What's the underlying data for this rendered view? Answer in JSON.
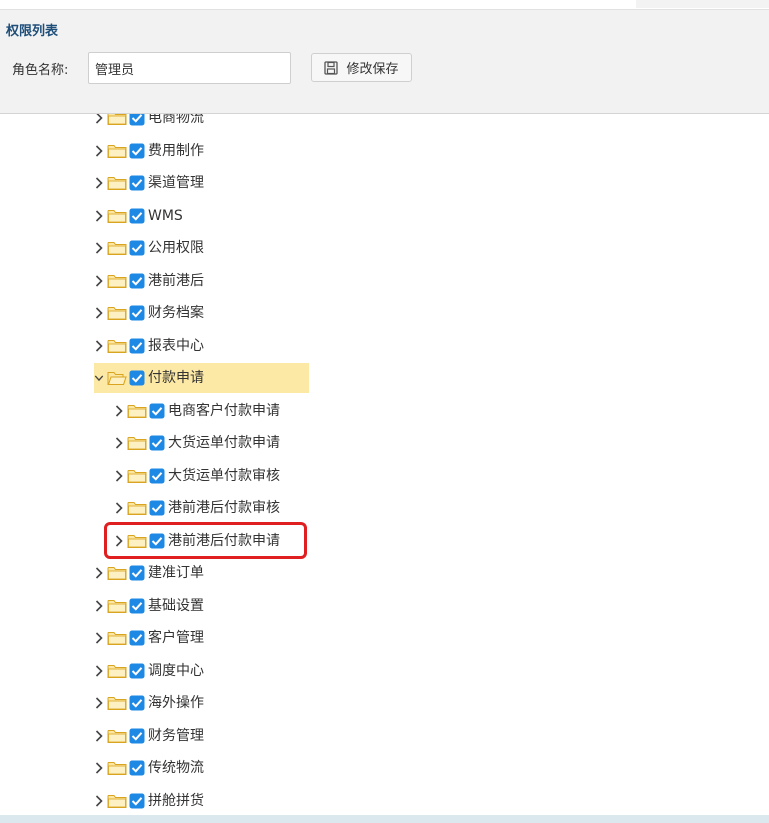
{
  "panel": {
    "title": "权限列表",
    "role_label": "角色名称:",
    "role_value": "管理员",
    "save_label": "修改保存"
  },
  "tree": {
    "nodes": [
      {
        "label": "电商物流",
        "level": 0,
        "checked": true,
        "expanded": false
      },
      {
        "label": "费用制作",
        "level": 0,
        "checked": true,
        "expanded": false
      },
      {
        "label": "渠道管理",
        "level": 0,
        "checked": true,
        "expanded": false
      },
      {
        "label": "WMS",
        "level": 0,
        "checked": true,
        "expanded": false
      },
      {
        "label": "公用权限",
        "level": 0,
        "checked": true,
        "expanded": false
      },
      {
        "label": "港前港后",
        "level": 0,
        "checked": true,
        "expanded": false
      },
      {
        "label": "财务档案",
        "level": 0,
        "checked": true,
        "expanded": false
      },
      {
        "label": "报表中心",
        "level": 0,
        "checked": true,
        "expanded": false
      },
      {
        "label": "付款申请",
        "level": 0,
        "checked": true,
        "expanded": true,
        "selected": true
      },
      {
        "label": "电商客户付款申请",
        "level": 1,
        "checked": true,
        "expanded": false
      },
      {
        "label": "大货运单付款申请",
        "level": 1,
        "checked": true,
        "expanded": false
      },
      {
        "label": "大货运单付款审核",
        "level": 1,
        "checked": true,
        "expanded": false
      },
      {
        "label": "港前港后付款审核",
        "level": 1,
        "checked": true,
        "expanded": false
      },
      {
        "label": "港前港后付款申请",
        "level": 1,
        "checked": true,
        "expanded": false,
        "highlighted": true
      },
      {
        "label": "建准订单",
        "level": 0,
        "checked": true,
        "expanded": false
      },
      {
        "label": "基础设置",
        "level": 0,
        "checked": true,
        "expanded": false
      },
      {
        "label": "客户管理",
        "level": 0,
        "checked": true,
        "expanded": false
      },
      {
        "label": "调度中心",
        "level": 0,
        "checked": true,
        "expanded": false
      },
      {
        "label": "海外操作",
        "level": 0,
        "checked": true,
        "expanded": false
      },
      {
        "label": "财务管理",
        "level": 0,
        "checked": true,
        "expanded": false
      },
      {
        "label": "传统物流",
        "level": 0,
        "checked": true,
        "expanded": false
      },
      {
        "label": "拼舱拼货",
        "level": 0,
        "checked": true,
        "expanded": false
      }
    ]
  },
  "colors": {
    "accent_title": "#1f4e79",
    "checkbox": "#1e88e5",
    "folder_fill": "#fbe7a1",
    "folder_stroke": "#d9a520",
    "selected_row": "#fde9a6",
    "highlight_border": "#e02020"
  }
}
